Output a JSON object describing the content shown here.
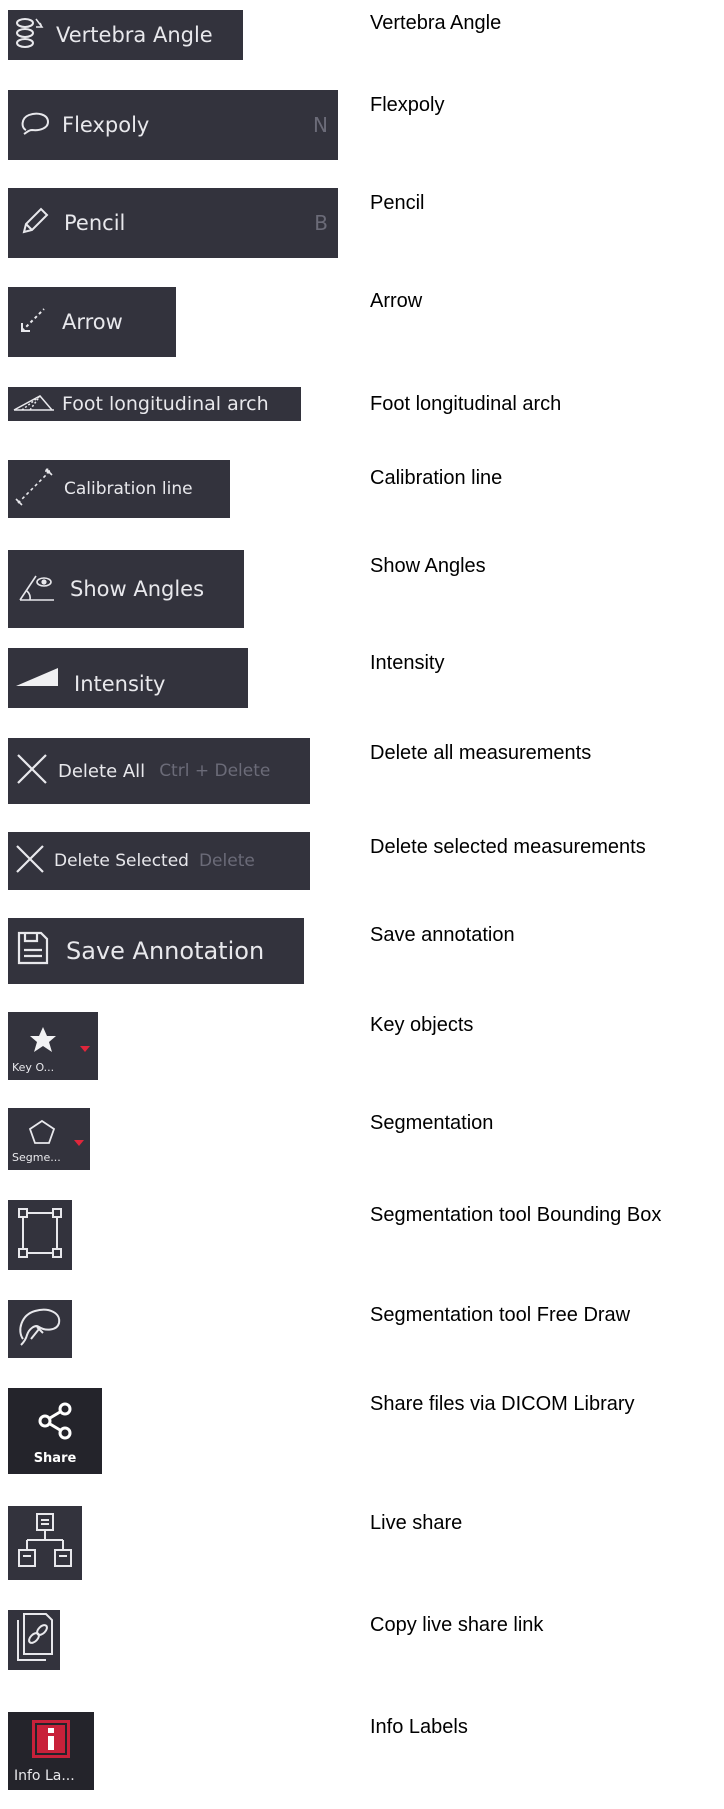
{
  "items": [
    {
      "button": "Vertebra Angle",
      "shortcut": "",
      "description": "Vertebra Angle",
      "icon": "vertebra-angle-icon"
    },
    {
      "button": "Flexpoly",
      "shortcut": "N",
      "description": "Flexpoly",
      "icon": "lasso-icon"
    },
    {
      "button": "Pencil",
      "shortcut": "B",
      "description": "Pencil",
      "icon": "pencil-icon"
    },
    {
      "button": "Arrow",
      "shortcut": "",
      "description": "Arrow",
      "icon": "arrow-icon"
    },
    {
      "button": "Foot longitudinal arch",
      "shortcut": "",
      "description": "Foot longitudinal arch",
      "icon": "arch-icon"
    },
    {
      "button": "Calibration line",
      "shortcut": "",
      "description": "Calibration line",
      "icon": "calibration-line-icon"
    },
    {
      "button": "Show Angles",
      "shortcut": "",
      "description": "Show Angles",
      "icon": "show-angles-icon"
    },
    {
      "button": "Intensity",
      "shortcut": "",
      "description": "Intensity",
      "icon": "intensity-icon"
    },
    {
      "button": "Delete All",
      "shortcut": "Ctrl + Delete",
      "description": "Delete all measurements",
      "icon": "close-icon"
    },
    {
      "button": "Delete Selected",
      "shortcut": "Delete",
      "description": "Delete selected measurements",
      "icon": "close-icon"
    },
    {
      "button": "Save Annotation",
      "shortcut": "",
      "description": "Save annotation",
      "icon": "save-icon"
    },
    {
      "button": "Key O...",
      "shortcut": "",
      "description": "Key objects",
      "icon": "star-icon"
    },
    {
      "button": "Segme...",
      "shortcut": "",
      "description": "Segmentation",
      "icon": "pentagon-icon"
    },
    {
      "button": "",
      "shortcut": "",
      "description": "Segmentation tool Bounding Box",
      "icon": "bounding-box-icon"
    },
    {
      "button": "",
      "shortcut": "",
      "description": "Segmentation tool Free Draw",
      "icon": "free-draw-icon"
    },
    {
      "button": "Share",
      "shortcut": "",
      "description": "Share files via DICOM Library",
      "icon": "share-icon"
    },
    {
      "button": "",
      "shortcut": "",
      "description": "Live share",
      "icon": "network-icon"
    },
    {
      "button": "",
      "shortcut": "",
      "description": "Copy live share link",
      "icon": "copy-link-icon"
    },
    {
      "button": "Info La...",
      "shortcut": "",
      "description": "Info Labels",
      "icon": "info-icon"
    }
  ],
  "colors": {
    "button_bg": "#33333d",
    "button_text": "#e8e8ec",
    "shortcut_text": "#6b6b78",
    "accent_red": "#e0263b"
  }
}
